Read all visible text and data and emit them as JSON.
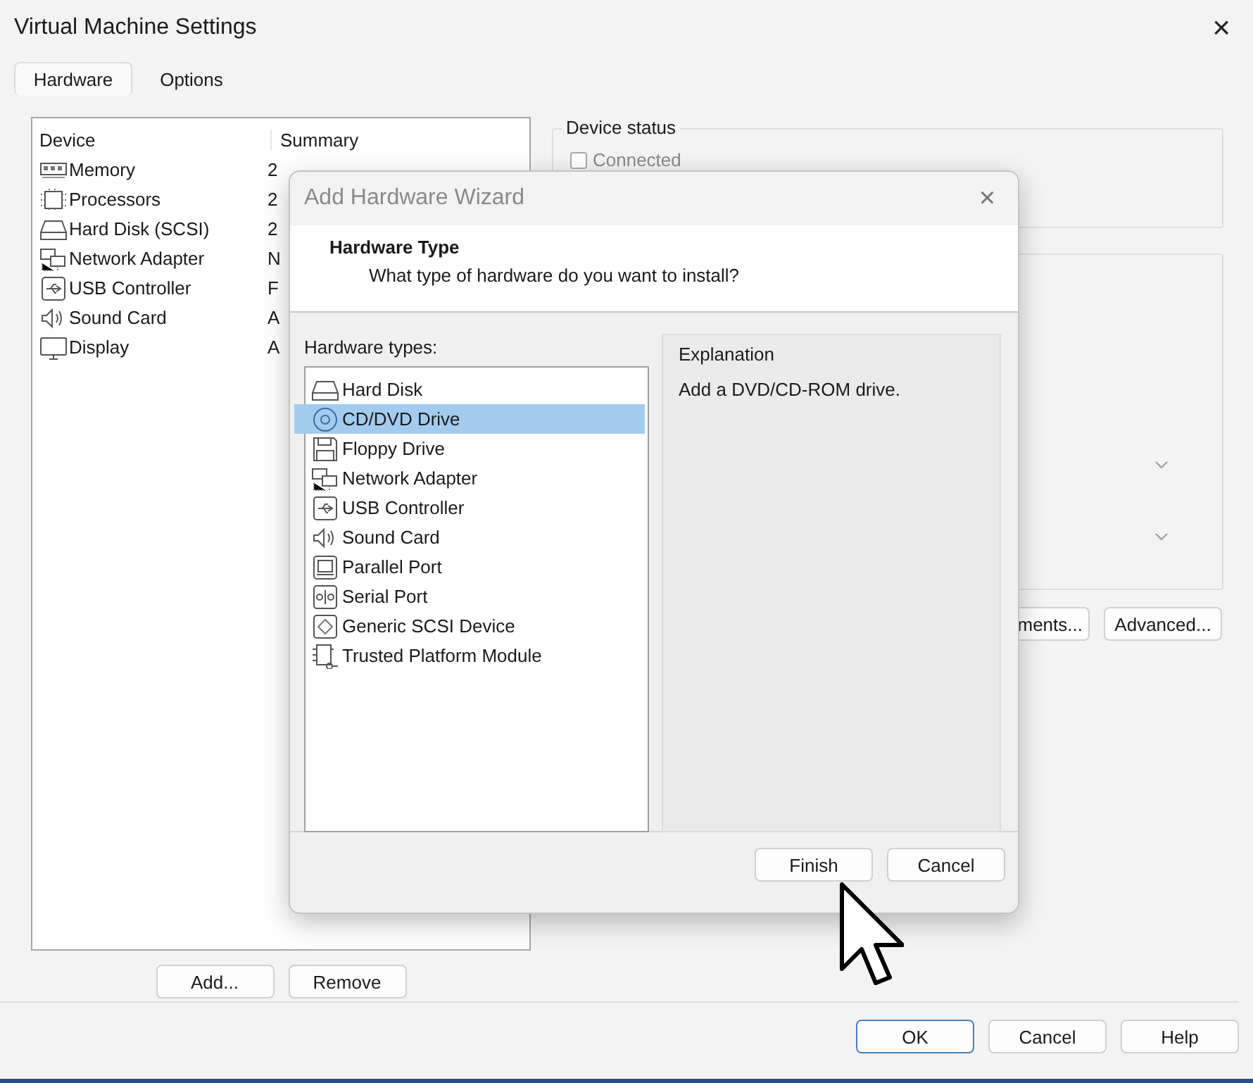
{
  "window": {
    "title": "Virtual Machine Settings",
    "close": "×"
  },
  "tabs": [
    {
      "label": "Hardware",
      "selected": true
    },
    {
      "label": "Options",
      "selected": false
    }
  ],
  "device_list": {
    "columns": [
      "Device",
      "Summary"
    ],
    "rows": [
      {
        "device": "Memory",
        "summary": "2"
      },
      {
        "device": "Processors",
        "summary": "2"
      },
      {
        "device": "Hard Disk (SCSI)",
        "summary": "2"
      },
      {
        "device": "Network Adapter",
        "summary": "N"
      },
      {
        "device": "USB Controller",
        "summary": "F"
      },
      {
        "device": "Sound Card",
        "summary": "A"
      },
      {
        "device": "Display",
        "summary": "A"
      }
    ]
  },
  "list_buttons": [
    "Add...",
    "Remove"
  ],
  "device_status": {
    "title": "Device status",
    "connected": {
      "label": "Connected",
      "checked": false
    }
  },
  "right_buttons": [
    "ments...",
    "Advanced..."
  ],
  "buttons": [
    "OK",
    "Cancel",
    "Help"
  ],
  "wizard": {
    "title": "Add Hardware Wizard",
    "close": "×",
    "heading": "Hardware Type",
    "subheading": "What type of hardware do you want to install?",
    "types_label": "Hardware types:",
    "types": [
      {
        "label": "Hard Disk",
        "selected": false
      },
      {
        "label": "CD/DVD Drive",
        "selected": true
      },
      {
        "label": "Floppy Drive",
        "selected": false
      },
      {
        "label": "Network Adapter",
        "selected": false
      },
      {
        "label": "USB Controller",
        "selected": false
      },
      {
        "label": "Sound Card",
        "selected": false
      },
      {
        "label": "Parallel Port",
        "selected": false
      },
      {
        "label": "Serial Port",
        "selected": false
      },
      {
        "label": "Generic SCSI Device",
        "selected": false
      },
      {
        "label": "Trusted Platform Module",
        "selected": false
      }
    ],
    "explanation_label": "Explanation",
    "explanation": "Add a DVD/CD-ROM drive.",
    "buttons": [
      "Finish",
      "Cancel"
    ]
  }
}
